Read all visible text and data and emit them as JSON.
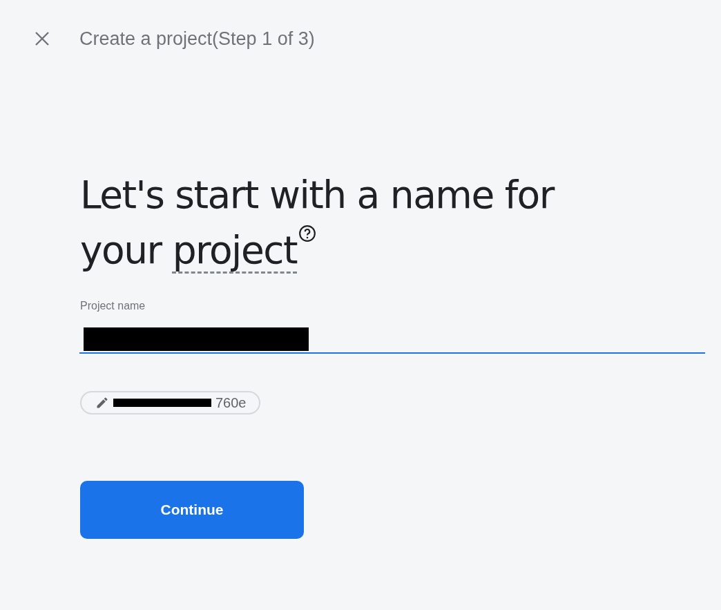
{
  "header": {
    "title": "Create a project(Step 1 of 3)"
  },
  "heading": {
    "line_1": "Let's start with a name for",
    "line_2_prefix": "your ",
    "term": "project"
  },
  "field": {
    "label": "Project name",
    "redacted": true
  },
  "project_id_chip": {
    "redacted": true,
    "suffix": "760e"
  },
  "buttons": [
    {
      "label": "Continue",
      "kind": "primary"
    }
  ]
}
